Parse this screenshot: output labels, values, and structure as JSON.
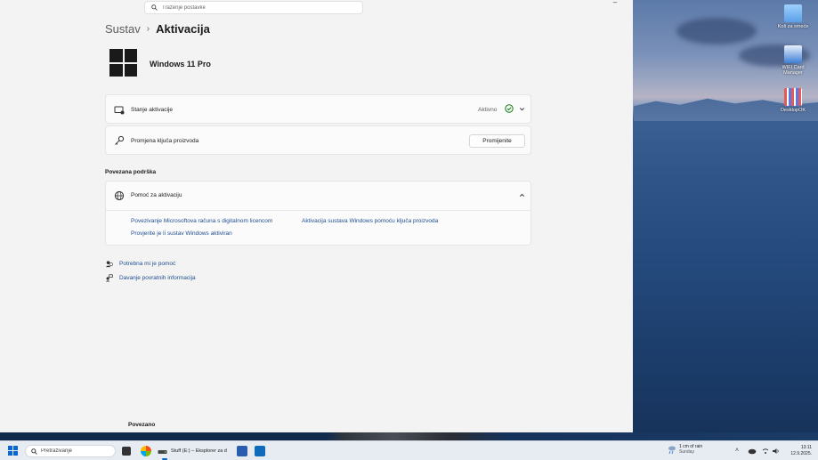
{
  "desktop": {
    "icons": [
      {
        "name": "recycle-bin",
        "label": "Koš za smeće",
        "color": "#5aa0e8"
      },
      {
        "name": "wifi-card-manager",
        "label": "WIFI Card Manager",
        "color": "#3d7fd6"
      },
      {
        "name": "desktopok",
        "label": "DesktopOK",
        "color": "#e25a5a"
      }
    ]
  },
  "settings": {
    "search": {
      "placeholder": "Traženje postavke"
    },
    "breadcrumb": {
      "parent": "Sustav",
      "separator": "›",
      "current": "Aktivacija"
    },
    "edition": "Windows 11 Pro",
    "activation_state": {
      "label": "Stanje aktivacije",
      "status": "Aktivno",
      "icon": "computer-activation-icon",
      "status_color": "#0f7b0f"
    },
    "product_key": {
      "label": "Promjena ključa proizvoda",
      "button": "Promijenite",
      "icon": "key-icon"
    },
    "related_support": {
      "title": "Povezana podrška",
      "help_item": {
        "label": "Pomoć za aktivaciju",
        "icon": "globe-icon"
      },
      "links": [
        "Povezivanje Microsoftova računa s digitalnom licencom",
        "Aktivacija sustava Windows pomoću ključa proizvoda",
        "Provjerite je li sustav Windows aktiviran"
      ]
    },
    "footer_links": [
      {
        "label": "Potrebna mi je pomoć",
        "icon": "help-person-icon"
      },
      {
        "label": "Davanje povratnih informacija",
        "icon": "feedback-icon"
      }
    ],
    "related_bottom": "Povezano"
  },
  "taskbar": {
    "search_placeholder": "Pretraživanje",
    "active_app": "Stuff (E:) – Eksplorer za d",
    "weather": {
      "line1": "1 cm of rain",
      "line2": "Sunday"
    },
    "time": "13:11",
    "date": "12.9.2025.",
    "accent": "#0a66d0"
  }
}
